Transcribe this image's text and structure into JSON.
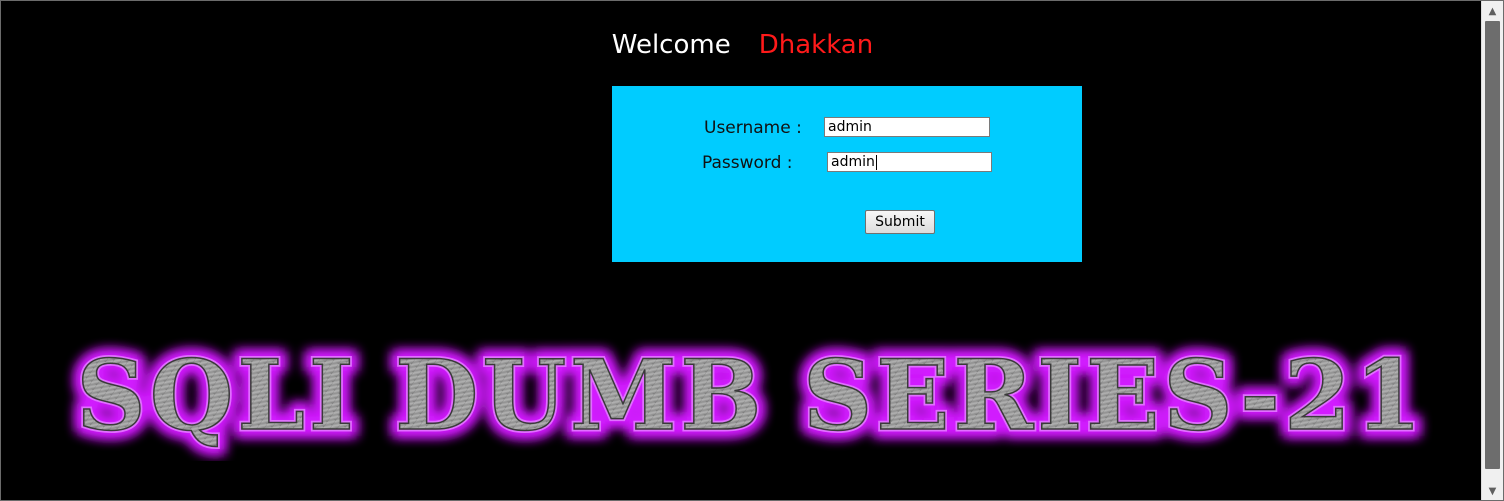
{
  "header": {
    "welcome_text": "Welcome",
    "name_text": "Dhakkan"
  },
  "login_form": {
    "username_label": "Username :",
    "password_label": "Password :",
    "username_value": "admin",
    "password_value": "admin",
    "submit_label": "Submit"
  },
  "banner": {
    "title": "SQLI DUMB SERIES-21"
  },
  "scrollbar": {
    "up_icon": "chevron-up-icon",
    "down_icon": "chevron-down-icon"
  },
  "colors": {
    "background": "#000000",
    "form_background": "#00ccff",
    "name_color": "#ff1a1a",
    "banner_glow": "#d21cff",
    "banner_fill": "#9a9a9a"
  }
}
